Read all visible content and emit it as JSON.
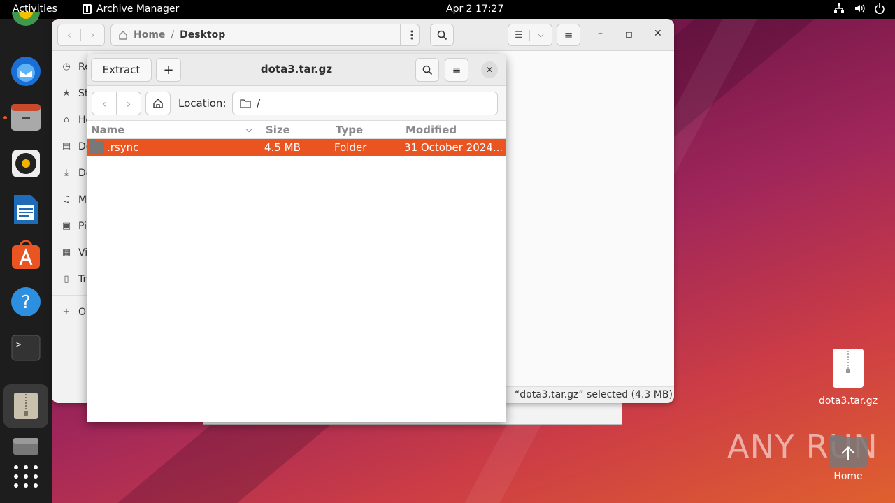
{
  "topbar": {
    "activities": "Activities",
    "app_name": "Archive Manager",
    "clock": "Apr 2  17:27"
  },
  "files_window": {
    "breadcrumb_home": "Home",
    "breadcrumb_sep": "/",
    "breadcrumb_current": "Desktop",
    "sidebar": [
      "Re",
      "St",
      "Ho",
      "Do",
      "Do",
      "Mu",
      "Pi",
      "Vi",
      "Tr",
      "O"
    ],
    "status": "“dota3.tar.gz” selected  (4.3 MB)"
  },
  "archive": {
    "extract_label": "Extract",
    "add_label": "+",
    "title": "dota3.tar.gz",
    "location_label": "Location:",
    "location_value": "/",
    "columns": {
      "name": "Name",
      "size": "Size",
      "type": "Type",
      "modified": "Modified"
    },
    "row": {
      "name": ".rsync",
      "size": "4.5 MB",
      "type": "Folder",
      "modified": "31 October 2024..."
    }
  },
  "desktop": {
    "archive_icon_label": "dota3.tar.gz",
    "home_icon_label": "Home"
  },
  "watermark": "ANY RUN",
  "colors": {
    "accent": "#e95420",
    "topbar": "#000000",
    "dock": "#1d1d1d"
  }
}
